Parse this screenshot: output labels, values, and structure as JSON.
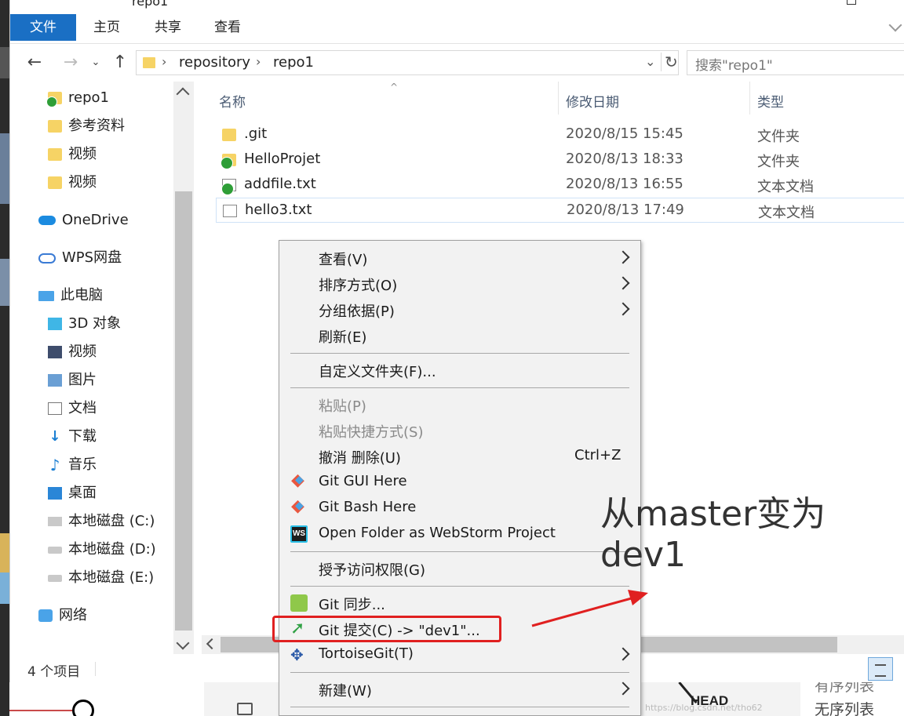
{
  "window": {
    "title": "repo1"
  },
  "ribbon": {
    "tabs": [
      "文件",
      "主页",
      "共享",
      "查看"
    ]
  },
  "address": {
    "crumbs": [
      "repository",
      "repo1"
    ],
    "search_placeholder": "搜索\"repo1\""
  },
  "nav": {
    "items": [
      "repo1",
      "参考资料",
      "视频",
      "视频",
      "OneDrive",
      "WPS网盘",
      "此电脑",
      "3D 对象",
      "视频",
      "图片",
      "文档",
      "下载",
      "音乐",
      "桌面",
      "本地磁盘 (C:)",
      "本地磁盘 (D:)",
      "本地磁盘 (E:)",
      "网络"
    ]
  },
  "columns": {
    "name": "名称",
    "date": "修改日期",
    "type": "类型"
  },
  "files": [
    {
      "name": ".git",
      "date": "2020/8/15 15:45",
      "type": "文件夹",
      "icon": "folder"
    },
    {
      "name": "HelloProjet",
      "date": "2020/8/13 18:33",
      "type": "文件夹",
      "icon": "git-folder"
    },
    {
      "name": "addfile.txt",
      "date": "2020/8/13 16:55",
      "type": "文本文档",
      "icon": "git-text"
    },
    {
      "name": "hello3.txt",
      "date": "2020/8/13 17:49",
      "type": "文本文档",
      "icon": "text"
    }
  ],
  "status": {
    "count": "4 个项目"
  },
  "context_menu": {
    "items": [
      {
        "label": "查看(V)",
        "submenu": true
      },
      {
        "label": "排序方式(O)",
        "submenu": true
      },
      {
        "label": "分组依据(P)",
        "submenu": true
      },
      {
        "label": "刷新(E)"
      },
      {
        "label": "自定义文件夹(F)..."
      },
      {
        "label": "粘贴(P)",
        "disabled": true
      },
      {
        "label": "粘贴快捷方式(S)",
        "disabled": true
      },
      {
        "label": "撤消 删除(U)",
        "shortcut": "Ctrl+Z"
      },
      {
        "label": "Git GUI Here",
        "icon": "git-gui-icon"
      },
      {
        "label": "Git Bash Here",
        "icon": "git-bash-icon"
      },
      {
        "label": "Open Folder as WebStorm Project",
        "icon": "webstorm-icon",
        "icon_text": "WS"
      },
      {
        "label": "授予访问权限(G)"
      },
      {
        "label": "Git 同步...",
        "icon": "git-sync-icon"
      },
      {
        "label": "Git 提交(C) -> \"dev1\"...",
        "icon": "git-commit-icon"
      },
      {
        "label": "TortoiseGit(T)",
        "submenu": true,
        "icon": "tortoisegit-icon"
      },
      {
        "label": "新建(W)",
        "submenu": true
      }
    ]
  },
  "annotation": {
    "line1": "从master变为",
    "line2": "dev1"
  },
  "background": {
    "head_label": "HEAD",
    "ordered_list": "有序列表",
    "unordered_list": "无序列表",
    "watermark": "https://blog.csdn.net/tho62"
  },
  "colors": {
    "accent": "#1a6fc4",
    "highlight": "#e02020"
  }
}
